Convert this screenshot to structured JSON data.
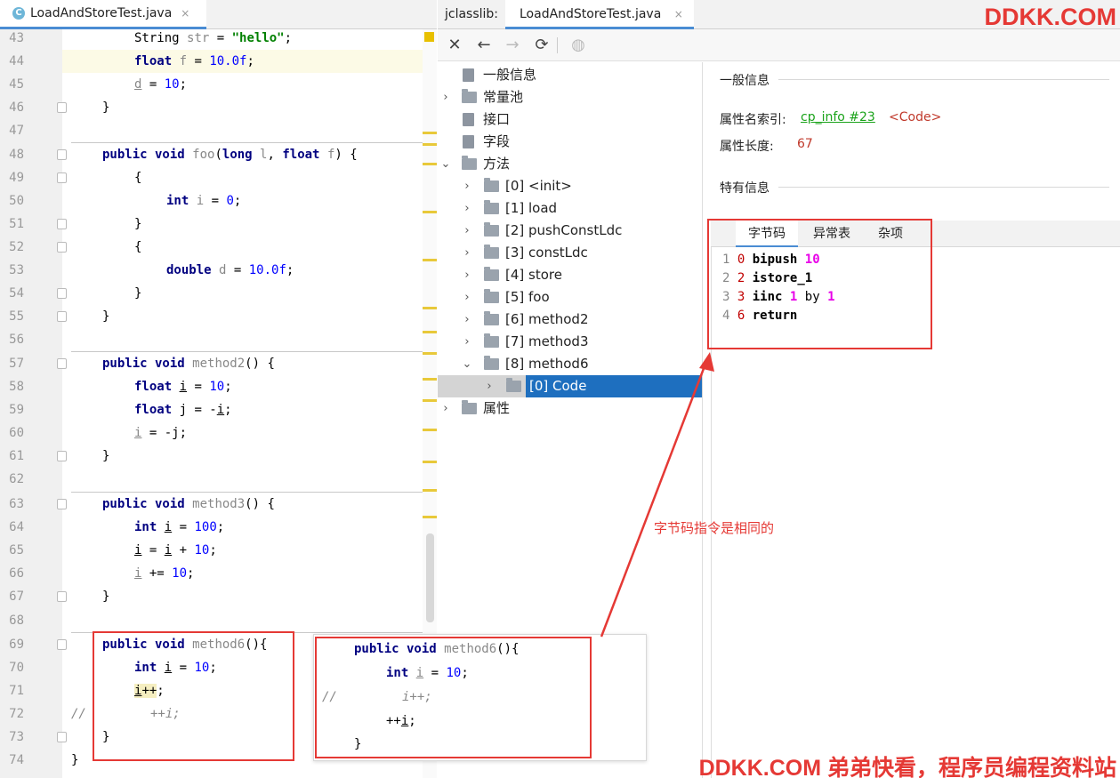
{
  "editor": {
    "tab": {
      "icon": "C",
      "title": "LoadAndStoreTest.java",
      "close": "×"
    },
    "line_numbers": [
      "43",
      "44",
      "45",
      "46",
      "47",
      "48",
      "49",
      "50",
      "51",
      "52",
      "53",
      "54",
      "55",
      "56",
      "57",
      "58",
      "59",
      "60",
      "61",
      "62",
      "63",
      "64",
      "65",
      "66",
      "67",
      "68",
      "69",
      "70",
      "71",
      "72",
      "73",
      "74"
    ],
    "comment_marker": "//"
  },
  "jclasslib": {
    "prefix": "jclasslib:",
    "tab_title": "LoadAndStoreTest.java",
    "tab_close": "×",
    "toolbar": [
      "close-icon",
      "back-icon",
      "forward-icon",
      "refresh-icon",
      "browser-icon"
    ],
    "tree": [
      {
        "label": "一般信息"
      },
      {
        "label": "常量池"
      },
      {
        "label": "接口"
      },
      {
        "label": "字段"
      },
      {
        "label": "方法"
      },
      {
        "label": "[0] <init>"
      },
      {
        "label": "[1] load"
      },
      {
        "label": "[2] pushConstLdc"
      },
      {
        "label": "[3] constLdc"
      },
      {
        "label": "[4] store"
      },
      {
        "label": "[5] foo"
      },
      {
        "label": "[6] method2"
      },
      {
        "label": "[7] method3"
      },
      {
        "label": "[8] method6"
      },
      {
        "label": "[0] Code"
      },
      {
        "label": "属性"
      }
    ],
    "detail": {
      "general_title": "一般信息",
      "name_index_label": "属性名索引:",
      "name_index_link": "cp_info #23",
      "name_index_value": "<Code>",
      "length_label": "属性长度:",
      "length_value": "67",
      "specific_title": "特有信息",
      "subtabs": [
        "字节码",
        "异常表",
        "杂项"
      ],
      "bytecode": [
        {
          "ln": "1",
          "off": "0",
          "op": "bipush",
          "args": "10"
        },
        {
          "ln": "2",
          "off": "2",
          "op": "istore_1",
          "args": ""
        },
        {
          "ln": "3",
          "off": "3",
          "op": "iinc",
          "args": "1",
          "by": "by",
          "args2": "1"
        },
        {
          "ln": "4",
          "off": "6",
          "op": "return",
          "args": ""
        }
      ]
    }
  },
  "annotation": "字节码指令是相同的",
  "watermark_top": "DDKK.COM",
  "watermark_bottom": "DDKK.COM 弟弟快看，程序员编程资料站",
  "colors": {
    "accent": "#4a8cd3",
    "selection": "#1e6fbf",
    "annotation_red": "#e53935"
  }
}
